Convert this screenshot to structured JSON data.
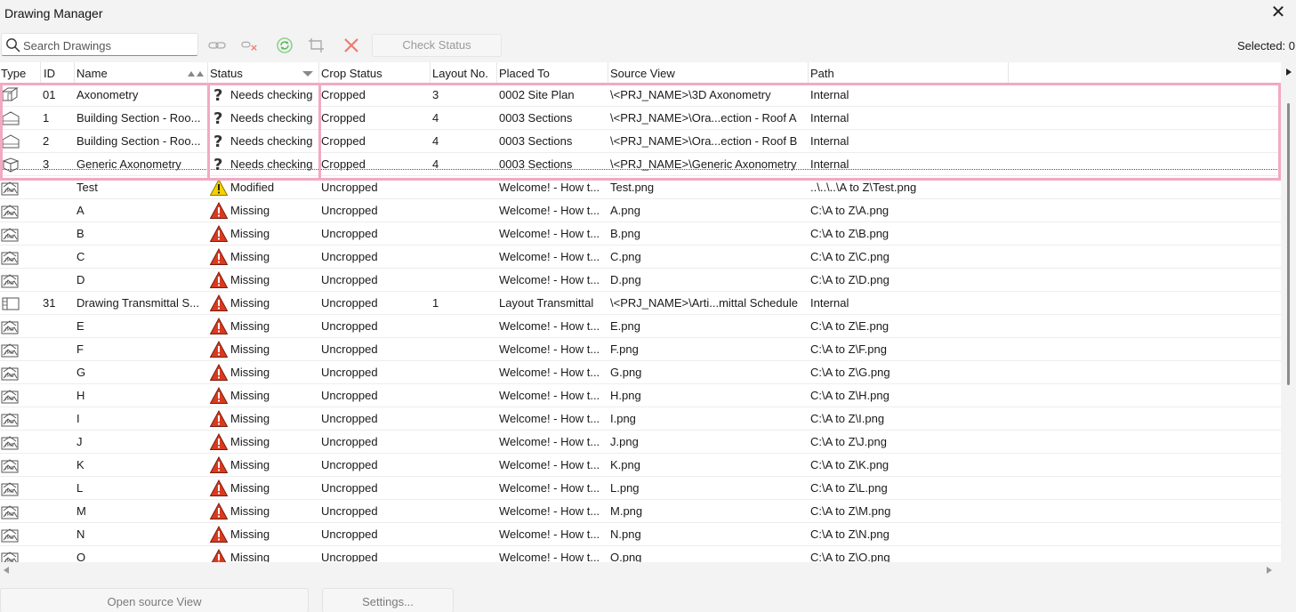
{
  "window": {
    "title": "Drawing Manager"
  },
  "toolbar": {
    "search_placeholder": "Search Drawings",
    "check_status_label": "Check Status",
    "selected_text": "Selected: 0"
  },
  "columns": {
    "type": "Type",
    "id": "ID",
    "name": "Name",
    "status": "Status",
    "crop": "Crop Status",
    "layout": "Layout No.",
    "placed": "Placed To",
    "source": "Source View",
    "path": "Path"
  },
  "rows": [
    {
      "icon": "axonometry-icon",
      "id": "01",
      "name": "Axonometry",
      "status": "Needs checking",
      "status_icon": "question-icon",
      "crop": "Cropped",
      "layout": "3",
      "placed": "0002 Site Plan",
      "source": "\\<PRJ_NAME>\\3D Axonometry",
      "path": "Internal"
    },
    {
      "icon": "section-icon",
      "id": "1",
      "name": "Building Section - Roo...",
      "status": "Needs checking",
      "status_icon": "question-icon",
      "crop": "Cropped",
      "layout": "4",
      "placed": "0003 Sections",
      "source": "\\<PRJ_NAME>\\Ora...ection - Roof A",
      "path": "Internal"
    },
    {
      "icon": "section-icon",
      "id": "2",
      "name": "Building Section - Roo...",
      "status": "Needs checking",
      "status_icon": "question-icon",
      "crop": "Cropped",
      "layout": "4",
      "placed": "0003 Sections",
      "source": "\\<PRJ_NAME>\\Ora...ection - Roof B",
      "path": "Internal"
    },
    {
      "icon": "generic-axonometry-icon",
      "id": "3",
      "name": "Generic Axonometry",
      "status": "Needs checking",
      "status_icon": "question-icon",
      "crop": "Cropped",
      "layout": "4",
      "placed": "0003 Sections",
      "source": "\\<PRJ_NAME>\\Generic Axonometry",
      "path": "Internal"
    },
    {
      "icon": "image-file-icon",
      "id": "",
      "name": "Test",
      "status": "Modified",
      "status_icon": "warning-icon",
      "crop": "Uncropped",
      "layout": "",
      "placed": "Welcome! - How t...",
      "source": "Test.png",
      "path": "..\\..\\..\\A to Z\\Test.png"
    },
    {
      "icon": "image-file-icon",
      "id": "",
      "name": "A",
      "status": "Missing",
      "status_icon": "error-icon",
      "crop": "Uncropped",
      "layout": "",
      "placed": "Welcome! - How t...",
      "source": "A.png",
      "path": "C:\\A to Z\\A.png"
    },
    {
      "icon": "image-file-icon",
      "id": "",
      "name": "B",
      "status": "Missing",
      "status_icon": "error-icon",
      "crop": "Uncropped",
      "layout": "",
      "placed": "Welcome! - How t...",
      "source": "B.png",
      "path": "C:\\A to Z\\B.png"
    },
    {
      "icon": "image-file-icon",
      "id": "",
      "name": "C",
      "status": "Missing",
      "status_icon": "error-icon",
      "crop": "Uncropped",
      "layout": "",
      "placed": "Welcome! - How t...",
      "source": "C.png",
      "path": "C:\\A to Z\\C.png"
    },
    {
      "icon": "image-file-icon",
      "id": "",
      "name": "D",
      "status": "Missing",
      "status_icon": "error-icon",
      "crop": "Uncropped",
      "layout": "",
      "placed": "Welcome! - How t...",
      "source": "D.png",
      "path": "C:\\A to Z\\D.png"
    },
    {
      "icon": "schedule-icon",
      "id": "31",
      "name": "Drawing Transmittal S...",
      "status": "Missing",
      "status_icon": "error-icon",
      "crop": "Uncropped",
      "layout": "1",
      "placed": "Layout Transmittal",
      "source": "\\<PRJ_NAME>\\Arti...mittal Schedule",
      "path": "Internal"
    },
    {
      "icon": "image-file-icon",
      "id": "",
      "name": "E",
      "status": "Missing",
      "status_icon": "error-icon",
      "crop": "Uncropped",
      "layout": "",
      "placed": "Welcome! - How t...",
      "source": "E.png",
      "path": "C:\\A to Z\\E.png"
    },
    {
      "icon": "image-file-icon",
      "id": "",
      "name": "F",
      "status": "Missing",
      "status_icon": "error-icon",
      "crop": "Uncropped",
      "layout": "",
      "placed": "Welcome! - How t...",
      "source": "F.png",
      "path": "C:\\A to Z\\F.png"
    },
    {
      "icon": "image-file-icon",
      "id": "",
      "name": "G",
      "status": "Missing",
      "status_icon": "error-icon",
      "crop": "Uncropped",
      "layout": "",
      "placed": "Welcome! - How t...",
      "source": "G.png",
      "path": "C:\\A to Z\\G.png"
    },
    {
      "icon": "image-file-icon",
      "id": "",
      "name": "H",
      "status": "Missing",
      "status_icon": "error-icon",
      "crop": "Uncropped",
      "layout": "",
      "placed": "Welcome! - How t...",
      "source": "H.png",
      "path": "C:\\A to Z\\H.png"
    },
    {
      "icon": "image-file-icon",
      "id": "",
      "name": "I",
      "status": "Missing",
      "status_icon": "error-icon",
      "crop": "Uncropped",
      "layout": "",
      "placed": "Welcome! - How t...",
      "source": "I.png",
      "path": "C:\\A to Z\\I.png"
    },
    {
      "icon": "image-file-icon",
      "id": "",
      "name": "J",
      "status": "Missing",
      "status_icon": "error-icon",
      "crop": "Uncropped",
      "layout": "",
      "placed": "Welcome! - How t...",
      "source": "J.png",
      "path": "C:\\A to Z\\J.png"
    },
    {
      "icon": "image-file-icon",
      "id": "",
      "name": "K",
      "status": "Missing",
      "status_icon": "error-icon",
      "crop": "Uncropped",
      "layout": "",
      "placed": "Welcome! - How t...",
      "source": "K.png",
      "path": "C:\\A to Z\\K.png"
    },
    {
      "icon": "image-file-icon",
      "id": "",
      "name": "L",
      "status": "Missing",
      "status_icon": "error-icon",
      "crop": "Uncropped",
      "layout": "",
      "placed": "Welcome! - How t...",
      "source": "L.png",
      "path": "C:\\A to Z\\L.png"
    },
    {
      "icon": "image-file-icon",
      "id": "",
      "name": "M",
      "status": "Missing",
      "status_icon": "error-icon",
      "crop": "Uncropped",
      "layout": "",
      "placed": "Welcome! - How t...",
      "source": "M.png",
      "path": "C:\\A to Z\\M.png"
    },
    {
      "icon": "image-file-icon",
      "id": "",
      "name": "N",
      "status": "Missing",
      "status_icon": "error-icon",
      "crop": "Uncropped",
      "layout": "",
      "placed": "Welcome! - How t...",
      "source": "N.png",
      "path": "C:\\A to Z\\N.png"
    },
    {
      "icon": "image-file-icon",
      "id": "",
      "name": "O",
      "status": "Missing",
      "status_icon": "error-icon",
      "crop": "Uncropped",
      "layout": "",
      "placed": "Welcome! - How t...",
      "source": "O.png",
      "path": "C:\\A to Z\\O.png"
    }
  ],
  "footer": {
    "open_source_label": "Open source View",
    "settings_label": "Settings..."
  },
  "colors": {
    "highlight": "#f2a9c4",
    "error": "#d93a1f",
    "warning": "#f5d000",
    "refresh": "#5cb85c",
    "delete": "#f07a6a"
  }
}
